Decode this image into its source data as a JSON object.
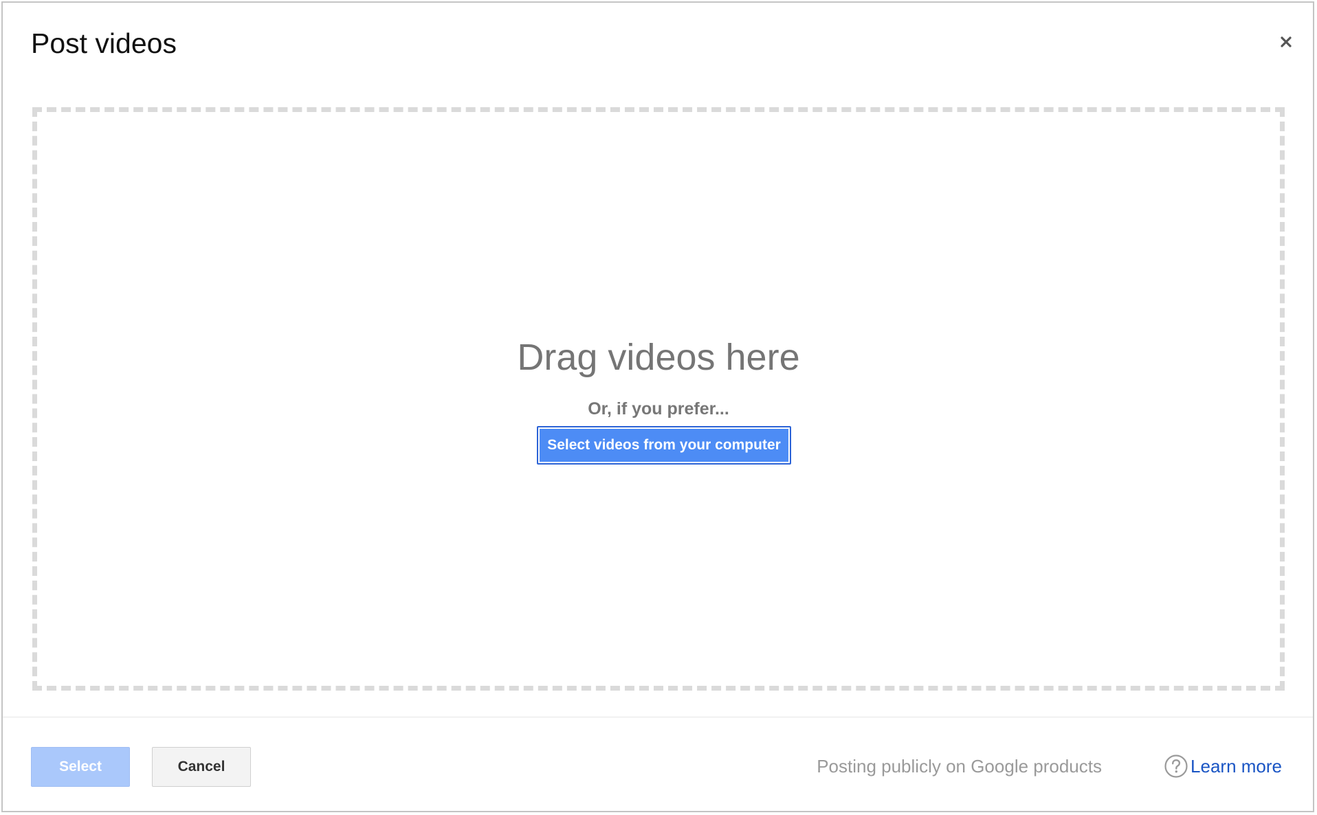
{
  "dialog": {
    "title": "Post videos",
    "close_icon": "close-icon"
  },
  "dropzone": {
    "heading": "Drag videos here",
    "alt_text": "Or, if you prefer...",
    "select_button_label": "Select videos from your computer"
  },
  "footer": {
    "select_label": "Select",
    "select_state": "disabled",
    "cancel_label": "Cancel",
    "posting_notice": "Posting publicly on Google products",
    "help_icon": "question-circle-icon",
    "learn_more_label": "Learn more"
  },
  "colors": {
    "primary_button": "#4d8cf5",
    "disabled_button": "#aac8fb",
    "link": "#1a55c4",
    "dropzone_border": "#dadada"
  }
}
